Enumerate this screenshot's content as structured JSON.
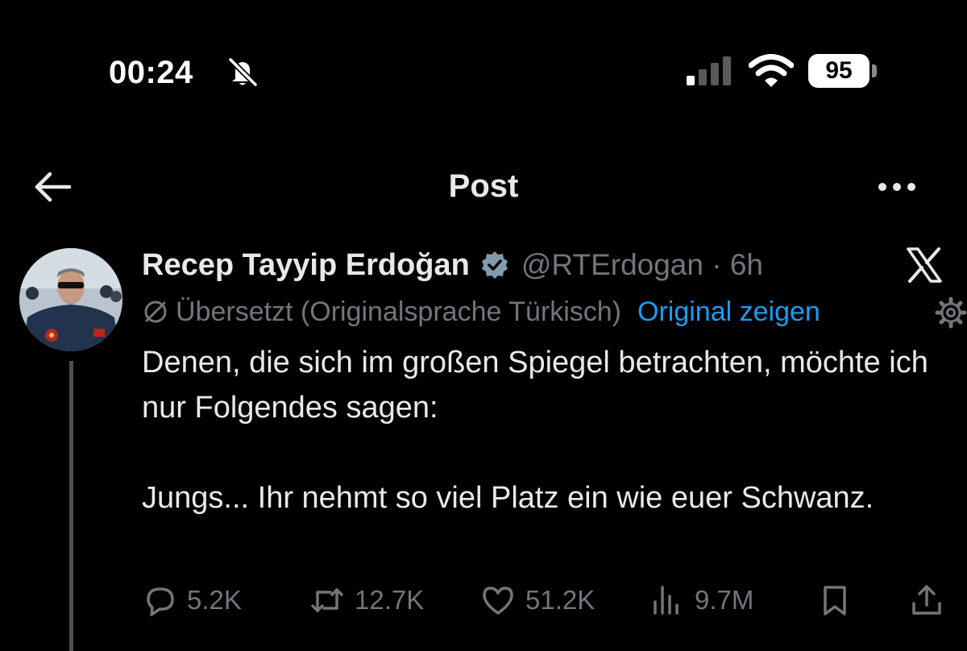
{
  "status_bar": {
    "time": "00:24",
    "battery_level": "95"
  },
  "header": {
    "title": "Post"
  },
  "post": {
    "author_name": "Recep Tayyip Erdoğan",
    "meta": "@RTErdogan · 6h",
    "translation_note": "Übersetzt (Originalsprache Türkisch)",
    "show_original_label": "Original zeigen",
    "paragraphs": [
      "Denen, die sich im großen Spiegel betrachten, möchte ich nur Folgendes sagen:",
      "Jungs... Ihr nehmt so viel Platz ein wie euer Schwanz."
    ],
    "actions": {
      "replies": "5.2K",
      "reposts": "12.7K",
      "likes": "51.2K",
      "views": "9.7M"
    }
  },
  "icons": {
    "status_mute": "bell-slash-icon",
    "signal": "cellular-signal-icon",
    "wifi": "wifi-icon",
    "back": "arrow-left-icon",
    "more": "ellipsis-icon",
    "verified": "verified-badge-icon",
    "platform": "x-logo-icon",
    "translate": "translate-icon",
    "settings": "gear-icon",
    "reply": "speech-bubble-icon",
    "repost": "repost-icon",
    "like": "heart-icon",
    "views": "bar-chart-icon",
    "bookmark": "bookmark-icon",
    "share": "share-icon"
  },
  "colors": {
    "background": "#000000",
    "text_primary": "#e7e9ea",
    "text_secondary": "#71767b",
    "link": "#1d9bf0",
    "verified_badge": "#829aab"
  }
}
